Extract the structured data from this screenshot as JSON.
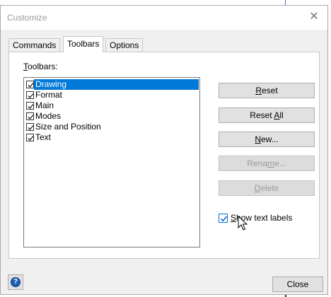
{
  "window": {
    "title": "Customize",
    "close_glyph": "✕"
  },
  "tabs": [
    {
      "label": "Commands"
    },
    {
      "label": "Toolbars",
      "active": true
    },
    {
      "label": "Options"
    }
  ],
  "toolbars_group": {
    "label_pre": "",
    "label_ul": "T",
    "label_post": "oolbars:",
    "items": [
      {
        "label": "Drawing",
        "checked": true,
        "selected": true
      },
      {
        "label": "Format",
        "checked": true
      },
      {
        "label": "Main",
        "checked": true
      },
      {
        "label": "Modes",
        "checked": true
      },
      {
        "label": "Size and Position",
        "checked": true
      },
      {
        "label": "Text",
        "checked": true
      }
    ]
  },
  "buttons": {
    "reset": {
      "pre": "",
      "ul": "R",
      "post": "eset"
    },
    "reset_all": {
      "pre": "Reset ",
      "ul": "A",
      "post": "ll"
    },
    "new": {
      "pre": "",
      "ul": "N",
      "post": "ew..."
    },
    "rename": {
      "pre": "Rena",
      "ul": "m",
      "post": "e..."
    },
    "delete": {
      "pre": "",
      "ul": "D",
      "post": "elete"
    }
  },
  "show_text_labels": {
    "pre": "",
    "ul": "S",
    "post": "how text labels",
    "checked": true
  },
  "footer": {
    "help_glyph": "?",
    "close_label": "Close"
  },
  "icons": {
    "help": "help-icon",
    "cursor": "mouse-pointer-icon",
    "check": "check-icon"
  },
  "colors": {
    "selection": "#0078d7",
    "face": "#f0f0f0",
    "accent": "#0078d7"
  }
}
